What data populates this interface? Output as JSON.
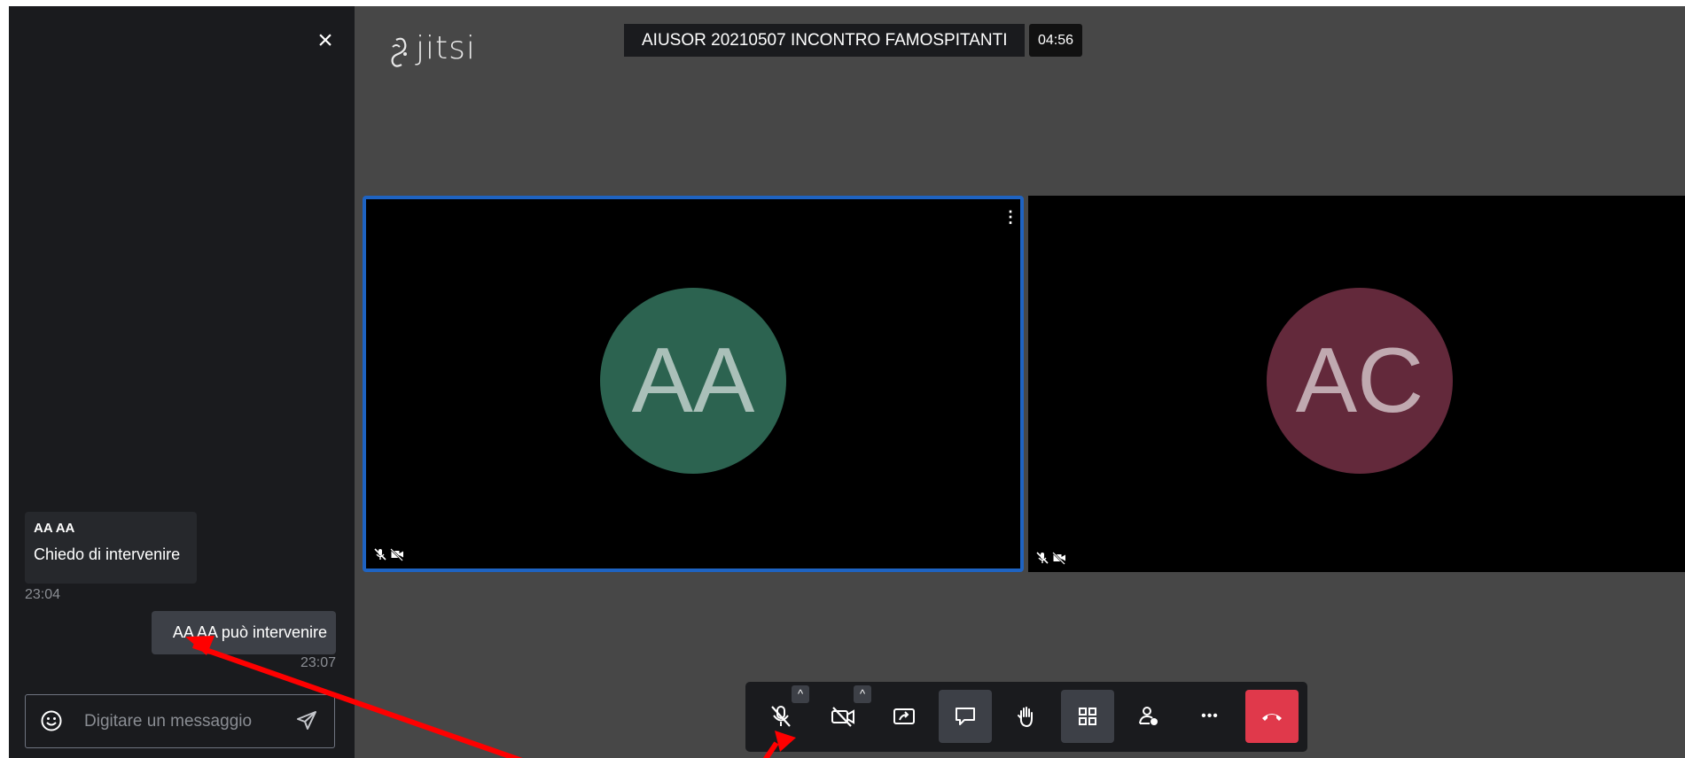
{
  "chat": {
    "close_label": "×",
    "messages": [
      {
        "sender": "AA AA",
        "text": "Chiedo di intervenire",
        "time": "23:04"
      },
      {
        "text": "AA AA può intervenire",
        "time": "23:07"
      }
    ],
    "input_placeholder": "Digitare un messaggio"
  },
  "header": {
    "logo": "jitsi",
    "subject": "AIUSOR 20210507 INCONTRO FAMOSPITANTI",
    "timer": "04:56"
  },
  "participants": [
    {
      "initials": "AA",
      "color": "#2c6350",
      "dominant": true
    },
    {
      "initials": "AC",
      "color": "#63293b",
      "dominant": false
    }
  ],
  "toolbar": {
    "buttons": [
      "microphone-muted",
      "camera-off",
      "share-screen",
      "chat",
      "raise-hand",
      "tile-view",
      "invite",
      "more-options",
      "hangup"
    ],
    "menu_dots": "⋮",
    "more_label": "•••",
    "arrow_label": "^"
  },
  "colors": {
    "accent": "#1e63c2",
    "hangup": "#e0394b",
    "panel": "#1a1b1e",
    "stage": "#474747"
  }
}
